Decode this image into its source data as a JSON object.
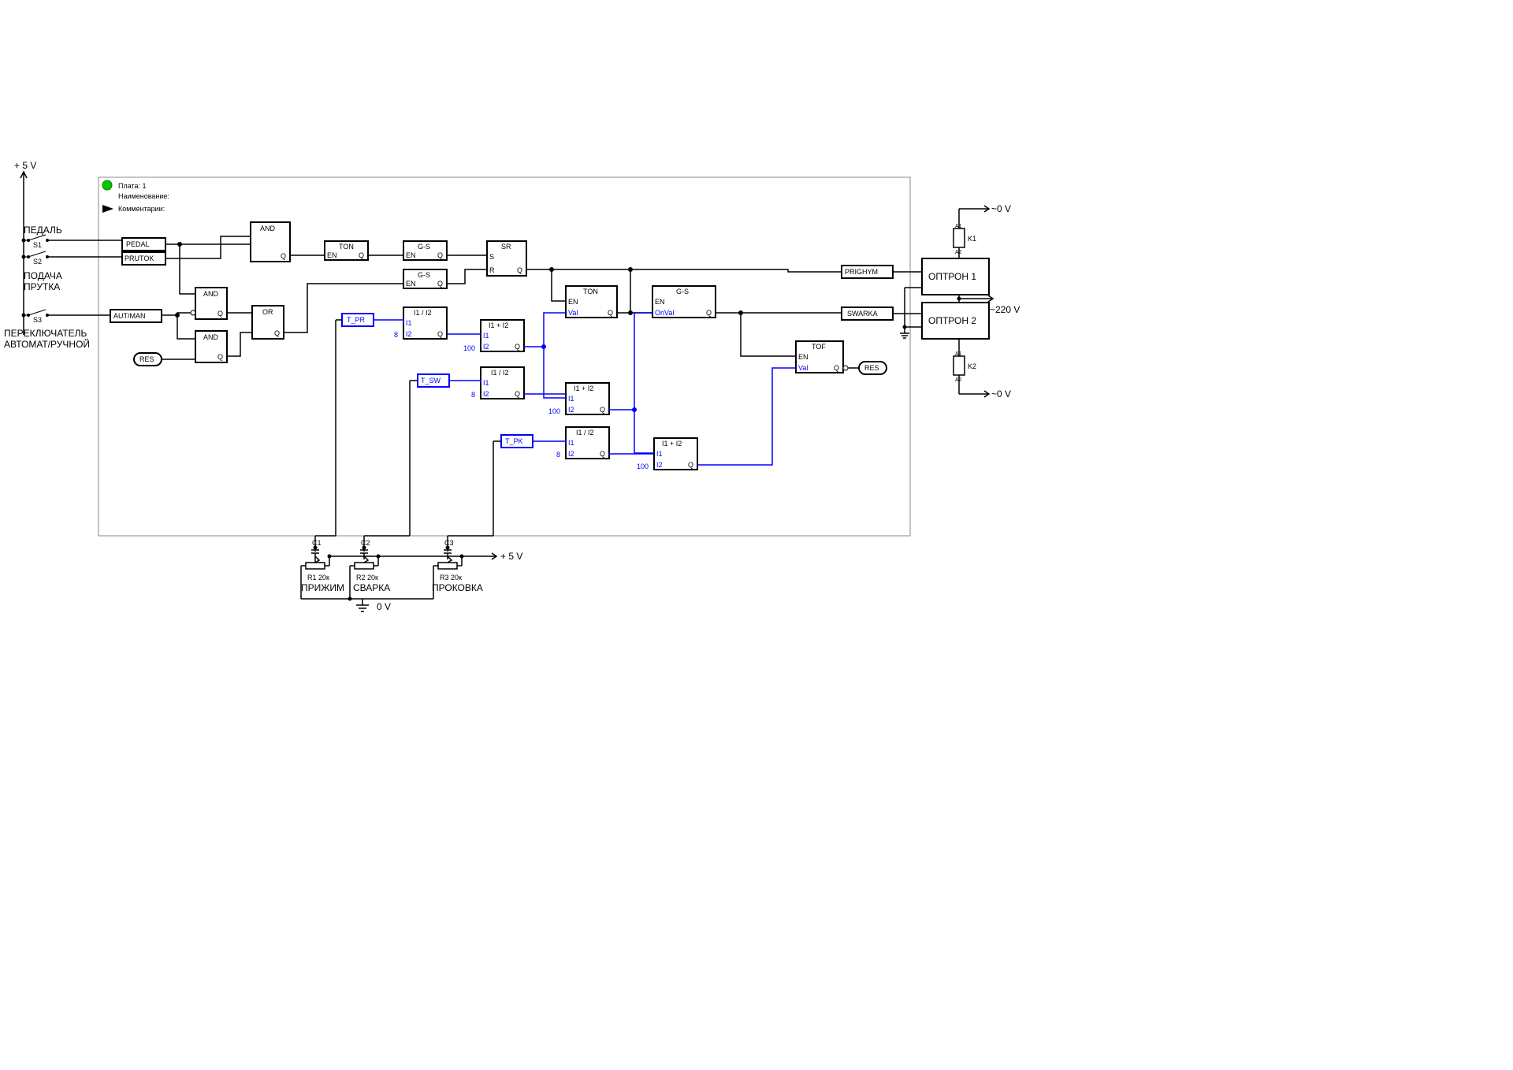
{
  "voltages": {
    "plus5v_left": "+ 5 V",
    "zero_v_bottom": "0  V",
    "plus5v_bottom": "+ 5 V",
    "tilde0v_top": "~0 V",
    "tilde220v": "~220 V",
    "tilde0v_bottom": "~0 V"
  },
  "header": {
    "board": "Плата: 1",
    "name": "Наименование:",
    "comment": "Комментарии:"
  },
  "left_labels": {
    "pedal": "ПЕДАЛЬ",
    "s1": "S1",
    "s2": "S2",
    "supply_rod": "ПОДАЧА ПРУТКА",
    "s3": "S3",
    "switch": "ПЕРЕКЛЮЧАТЕЛЬ АВТОМАТ/РУЧНОЙ"
  },
  "blocks": {
    "pedal": "PEDAL",
    "prutok": "PRUTOK",
    "aut_man": "AUT/MAN",
    "res": "RES",
    "and": "AND",
    "or": "OR",
    "ton": "TON",
    "gs": "G-S",
    "sr": "SR",
    "tof": "TOF",
    "t_pr": "T_PR",
    "t_sw": "T_SW",
    "t_pk": "T_PK",
    "prighym": "PRIGHYM",
    "swarka": "SWARKA",
    "optron1": "ОПТРОН 1",
    "optron2": "ОПТРОН 2"
  },
  "pins": {
    "q": "Q",
    "en": "EN",
    "s": "S",
    "r": "R",
    "val": "Val",
    "onval": "OnVal",
    "i1": "I1",
    "i2": "I2",
    "i1_i2_div": "I1 / I2",
    "i1_i2_add": "I1 + I2"
  },
  "constants": {
    "eight": "8",
    "hundred": "100"
  },
  "bottom": {
    "c1": "C1",
    "c2": "C2",
    "c3": "C3",
    "r1": "R1  20к",
    "r2": "R2  20к",
    "r3": "R3  20к",
    "prizhim": "ПРИЖИМ",
    "svarka": "СВАРКА",
    "prokovka": "ПРОКОВКА"
  },
  "relays": {
    "k1": "K1",
    "k2": "K2",
    "a1": "A1",
    "a2": "A2"
  }
}
